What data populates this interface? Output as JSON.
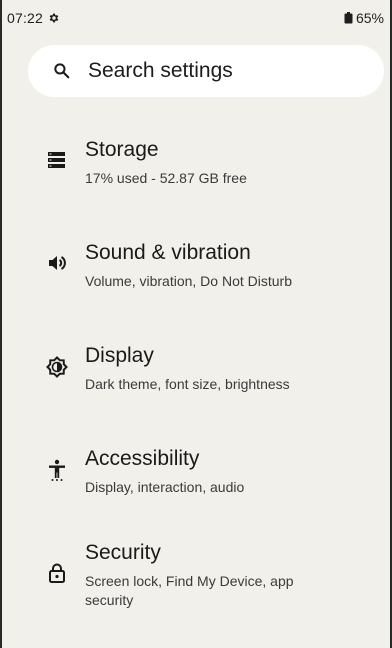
{
  "status_bar": {
    "time": "07:22",
    "settings_icon": "gear-icon",
    "battery_icon": "battery-icon",
    "battery_percent": "65%"
  },
  "search": {
    "icon": "search-icon",
    "placeholder": "Search settings"
  },
  "settings_items": [
    {
      "title": "Storage",
      "subtitle": "17% used - 52.87 GB free",
      "icon": "storage-icon"
    },
    {
      "title": "Sound & vibration",
      "subtitle": "Volume, vibration, Do Not Disturb",
      "icon": "volume-icon"
    },
    {
      "title": "Display",
      "subtitle": "Dark theme, font size, brightness",
      "icon": "brightness-icon"
    },
    {
      "title": "Accessibility",
      "subtitle": "Display, interaction, audio",
      "icon": "accessibility-icon"
    },
    {
      "title": "Security",
      "subtitle": "Screen lock, Find My Device, app security",
      "icon": "lock-icon"
    }
  ],
  "colors": {
    "background": "#f1f0ea",
    "search_background": "#ffffff",
    "text_primary": "#1a1a1a",
    "text_secondary": "#3a3a3a"
  }
}
